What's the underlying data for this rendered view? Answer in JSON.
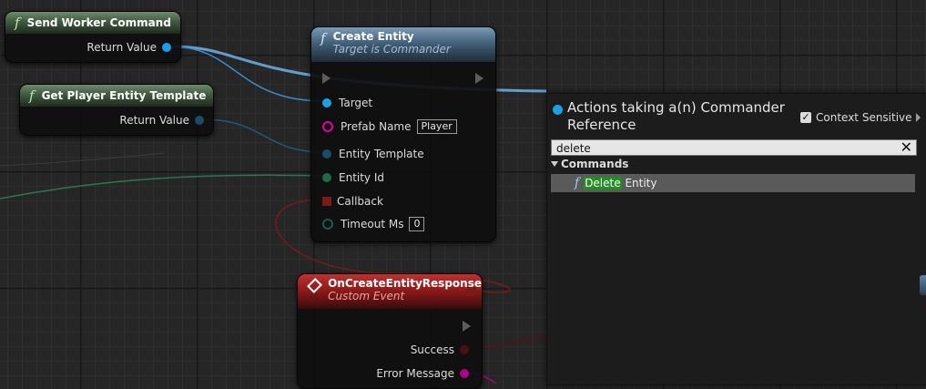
{
  "nodes": {
    "send_worker": {
      "title": "Send Worker Command",
      "return_label": "Return Value"
    },
    "get_template": {
      "title": "Get Player Entity Template",
      "return_label": "Return Value"
    },
    "create_entity": {
      "title": "Create Entity",
      "subtitle": "Target is Commander",
      "pins": {
        "target": "Target",
        "prefab_name": "Prefab Name",
        "prefab_value": "Player",
        "entity_template": "Entity Template",
        "entity_id": "Entity Id",
        "callback": "Callback",
        "timeout": "Timeout Ms",
        "timeout_value": "0"
      }
    },
    "on_create": {
      "title": "OnCreateEntityResponse",
      "subtitle": "Custom Event",
      "success": "Success",
      "error_message": "Error Message"
    }
  },
  "action_menu": {
    "title": "Actions taking a(n) Commander Reference",
    "context_label": "Context Sensitive",
    "search_value": "delete",
    "category": "Commands",
    "item_highlight": "Delete",
    "item_rest": " Entity"
  },
  "colors": {
    "object_pin": "#1aa0e6",
    "struct_pin": "#1b4d66",
    "entity_id_pin": "#1e6b4a",
    "string_pin": "#e000a0",
    "delegate_pin": "#7a1a1a",
    "float_pin": "#0f5f4a",
    "search_highlight": "#1f8f1f"
  }
}
